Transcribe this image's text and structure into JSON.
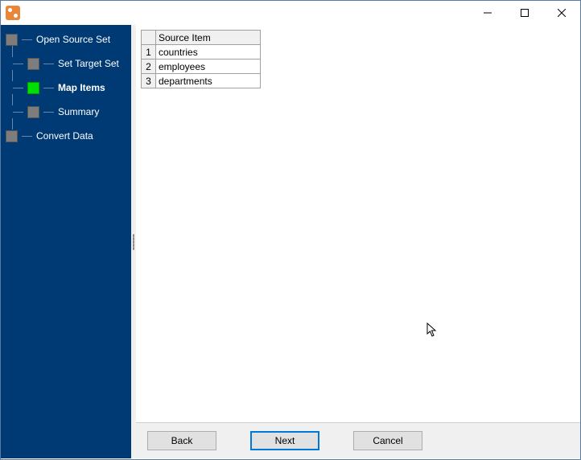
{
  "titlebar": {
    "title": ""
  },
  "sidebar": {
    "steps": [
      {
        "label": "Open Source Set",
        "active": false
      },
      {
        "label": "Set Target Set",
        "active": false
      },
      {
        "label": "Map Items",
        "active": true
      },
      {
        "label": "Summary",
        "active": false
      },
      {
        "label": "Convert Data",
        "active": false
      }
    ]
  },
  "grid": {
    "header": "Source Item",
    "rows": [
      {
        "n": "1",
        "item": "countries"
      },
      {
        "n": "2",
        "item": "employees"
      },
      {
        "n": "3",
        "item": "departments"
      }
    ]
  },
  "footer": {
    "back": "Back",
    "next": "Next",
    "cancel": "Cancel"
  }
}
